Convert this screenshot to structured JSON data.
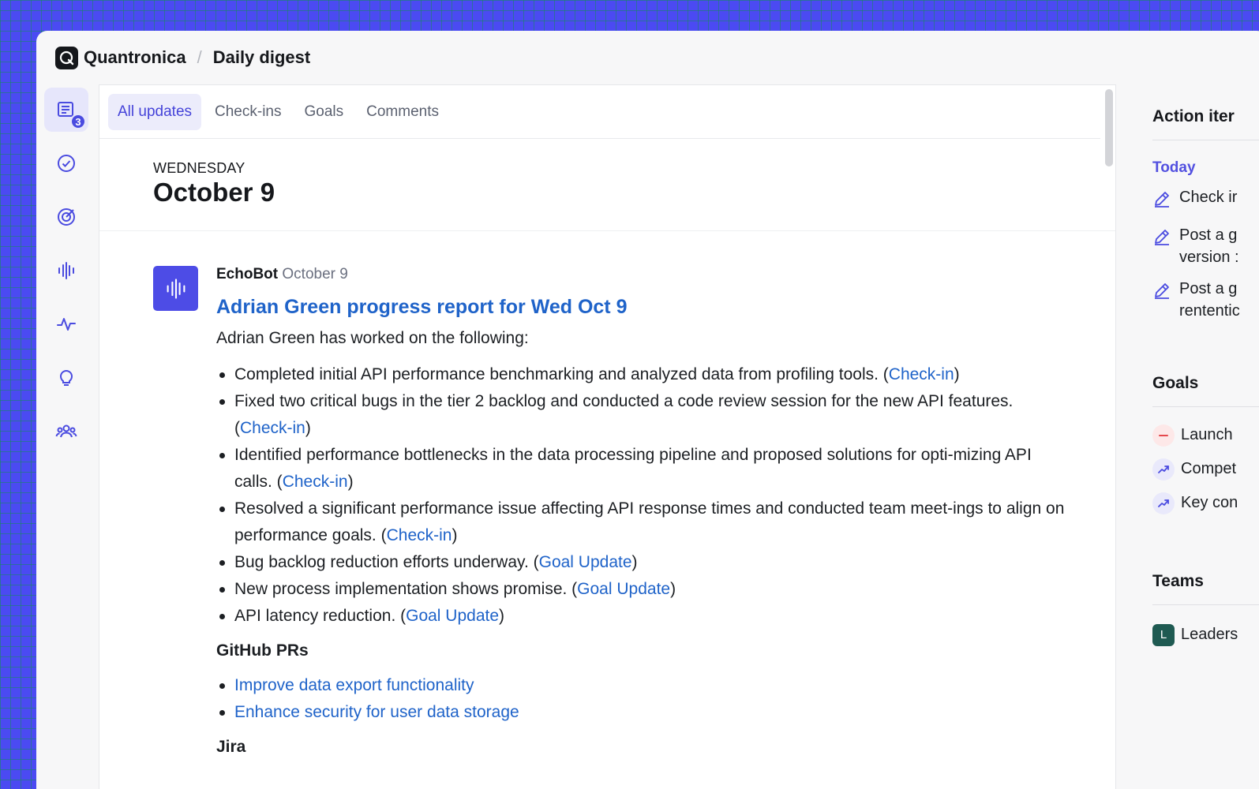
{
  "app": {
    "brand": "Quantronica",
    "page": "Daily digest"
  },
  "rail": {
    "badge_count": "3"
  },
  "tabs": [
    {
      "label": "All updates"
    },
    {
      "label": "Check-ins"
    },
    {
      "label": "Goals"
    },
    {
      "label": "Comments"
    }
  ],
  "day": {
    "weekday": "WEDNESDAY",
    "date": "October 9"
  },
  "post": {
    "author": "EchoBot",
    "date": "October 9",
    "title": "Adrian Green progress report for Wed Oct 9",
    "intro": "Adrian Green has worked on the following:",
    "bullets": [
      {
        "text": "Completed initial API performance benchmarking and analyzed data from profiling tools. (",
        "link": "Check-in",
        "close": ")"
      },
      {
        "text": "Fixed two critical bugs in the tier 2 backlog and conducted a code review session for the new API features. (",
        "link": "Check-in",
        "close": ")"
      },
      {
        "text": "Identified performance bottlenecks in the data processing pipeline and proposed solutions for opti-mizing API calls. (",
        "link": "Check-in",
        "close": ")"
      },
      {
        "text": "Resolved a significant performance issue affecting API response times and conducted team meet-ings to align on performance goals. (",
        "link": "Check-in",
        "close": ")"
      },
      {
        "text": "Bug backlog reduction efforts underway. (",
        "link": "Goal Update",
        "close": ")"
      },
      {
        "text": "New process implementation shows promise. (",
        "link": "Goal Update",
        "close": ")"
      },
      {
        "text": "API latency reduction. (",
        "link": "Goal Update",
        "close": ")"
      }
    ],
    "github_heading": "GitHub PRs",
    "github_prs": [
      "Improve data export functionality",
      "Enhance security for user data storage"
    ],
    "jira_heading": "Jira"
  },
  "sidebar": {
    "action_heading": "Action iter",
    "today_label": "Today",
    "actions": [
      {
        "line1": "Check ir",
        "line2": ""
      },
      {
        "line1": "Post a g",
        "line2": "version :"
      },
      {
        "line1": "Post a g",
        "line2": "rententic"
      }
    ],
    "goals_heading": "Goals",
    "goals": [
      {
        "label": "Launch",
        "status": "off-track",
        "color": "#e5484d"
      },
      {
        "label": "Compet",
        "status": "on-track",
        "color": "#4a4be0"
      },
      {
        "label": "Key con",
        "status": "on-track",
        "color": "#4a4be0"
      }
    ],
    "teams_heading": "Teams",
    "teams": [
      {
        "initial": "L",
        "label": "Leaders"
      }
    ]
  },
  "colors": {
    "accent": "#4a4be0",
    "link": "#1f63c9",
    "background": "#4b4af2"
  }
}
